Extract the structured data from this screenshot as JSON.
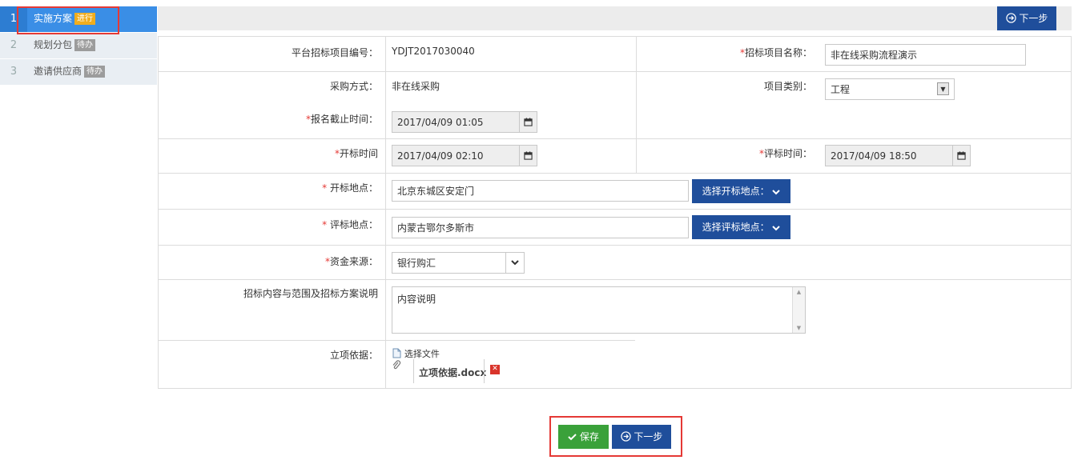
{
  "steps": [
    {
      "num": "1",
      "label": "实施方案",
      "badge": "进行"
    },
    {
      "num": "2",
      "label": "规划分包",
      "badge": "待办"
    },
    {
      "num": "3",
      "label": "邀请供应商",
      "badge": "待办"
    }
  ],
  "topbar": {
    "next_label": "下一步"
  },
  "form": {
    "project_no_label": "平台招标项目编号：",
    "project_no_value": "YDJT2017030040",
    "project_name_label": "招标项目名称：",
    "project_name_value": "非在线采购流程演示",
    "purchase_method_label": "采购方式：",
    "purchase_method_value": "非在线采购",
    "project_type_label": "项目类别：",
    "project_type_value": "工程",
    "signup_deadline_label": "报名截止时间：",
    "signup_deadline_value": "2017/04/09 01:05",
    "open_time_label": "开标时间",
    "open_time_value": "2017/04/09 02:10",
    "eval_time_label": "评标时间：",
    "eval_time_value": "2017/04/09 18:50",
    "open_place_label": " 开标地点：",
    "open_place_value": "北京东城区安定门",
    "open_place_button": "选择开标地点：",
    "eval_place_label": " 评标地点：",
    "eval_place_value": "内蒙古鄂尔多斯市",
    "eval_place_button": "选择评标地点：",
    "fund_source_label": "资金来源：",
    "fund_source_value": "银行购汇",
    "content_label": "招标内容与范围及招标方案说明",
    "content_value": "内容说明",
    "basis_label": "立项依据：",
    "choose_file_label": "选择文件",
    "file_name": "立项依据.docx"
  },
  "footer": {
    "save_label": "保存",
    "next_label": "下一步"
  },
  "required_mark": "*",
  "icons": {
    "calendar": "calendar-icon",
    "chevron": "chevron-down-icon",
    "next": "arrow-circle-right-icon",
    "save": "check-icon",
    "file": "file-icon",
    "attachment": "paperclip-icon",
    "delete": "close-icon"
  },
  "colors": {
    "primary": "#1f4e9b",
    "active_step": "#3a8ee6",
    "badge_active": "#f0ad1e",
    "save": "#3aa13a",
    "required": "#e53935"
  }
}
